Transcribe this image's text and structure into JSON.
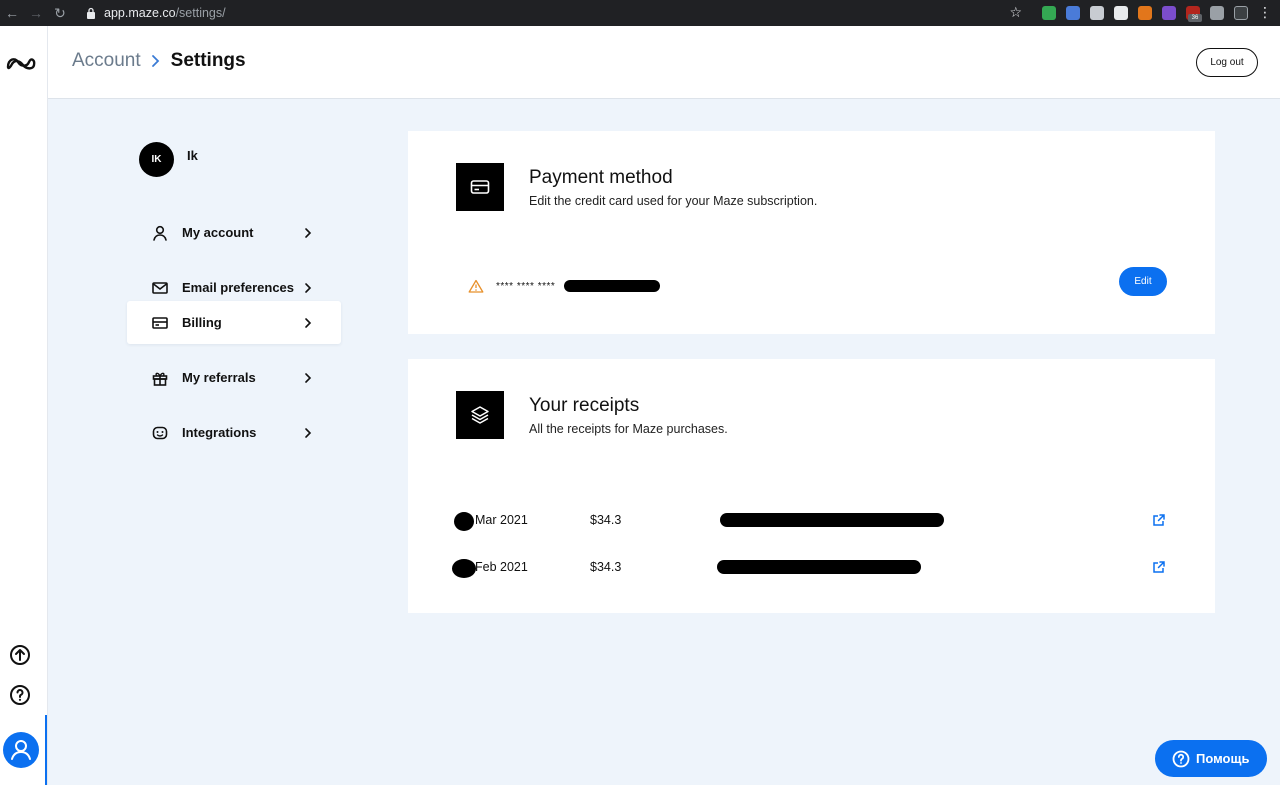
{
  "browser": {
    "url_host": "app.maze.co",
    "url_path": "/settings/",
    "badge_count": "36"
  },
  "header": {
    "breadcrumb_parent": "Account",
    "breadcrumb_current": "Settings",
    "logout_label": "Log out"
  },
  "user": {
    "initials": "IK",
    "name": "Ik"
  },
  "settings_nav": {
    "items": [
      {
        "label": "My account",
        "icon": "user-icon",
        "active": false
      },
      {
        "label": "Email preferences",
        "icon": "mail-icon",
        "active": false
      },
      {
        "label": "Billing",
        "icon": "credit-card-icon",
        "active": true
      },
      {
        "label": "My referrals",
        "icon": "gift-icon",
        "active": false
      },
      {
        "label": "Integrations",
        "icon": "plug-icon",
        "active": false
      }
    ]
  },
  "payment": {
    "title": "Payment method",
    "subtitle": "Edit the credit card used for your Maze subscription.",
    "card_masked": "**** **** ****",
    "edit_label": "Edit"
  },
  "receipts": {
    "title": "Your receipts",
    "subtitle": "All the receipts for Maze purchases.",
    "rows": [
      {
        "date": "Mar 2021",
        "amount": "$34.3"
      },
      {
        "date": "Feb 2021",
        "amount": "$34.3"
      }
    ]
  },
  "help": {
    "label": "Помощь"
  },
  "colors": {
    "accent": "#0b70f0",
    "background": "#eef4fb",
    "warning": "#e8902a"
  }
}
